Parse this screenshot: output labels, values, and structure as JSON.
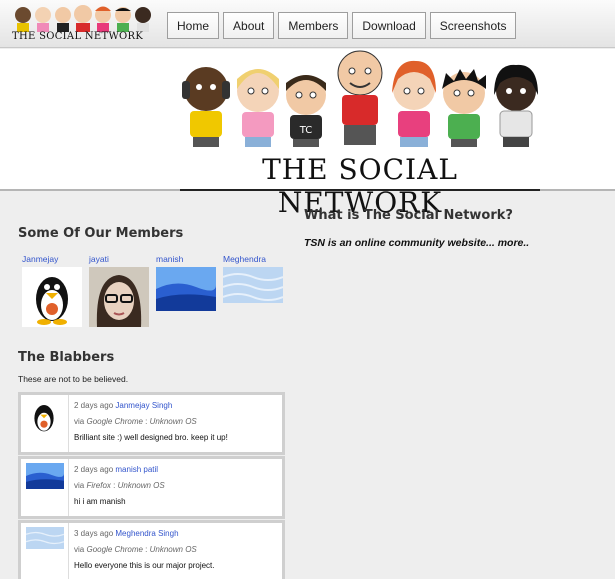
{
  "header": {
    "logo_text": "THE SOCIAL NETWORK",
    "nav": [
      "Home",
      "About",
      "Members",
      "Download",
      "Screenshots"
    ]
  },
  "banner": {
    "title": "THE SOCIAL NETWORK"
  },
  "members_section": {
    "title": "Some Of Our Members",
    "members": [
      {
        "name": "Janmejay",
        "avatar": "linux-penguin"
      },
      {
        "name": "jayati",
        "avatar": "girl-with-glasses"
      },
      {
        "name": "manish",
        "avatar": "blue-landscape"
      },
      {
        "name": "Meghendra",
        "avatar": "light-blue-waves"
      }
    ]
  },
  "blabbers": {
    "title": "The Blabbers",
    "subtitle": "These are not to be believed.",
    "comments": [
      {
        "when": "2 days ago",
        "author": "Janmejay Singh",
        "via_label": "via",
        "browser": "Google Chrome",
        "os": "Unknown OS",
        "text": "Brilliant site :) well designed bro. keep it up!",
        "avatar": "linux-penguin"
      },
      {
        "when": "2 days ago",
        "author": "manish patil",
        "via_label": "via",
        "browser": "Firefox",
        "os": "Unknown OS",
        "text": "hi i am manish",
        "avatar": "blue-landscape"
      },
      {
        "when": "3 days ago",
        "author": "Meghendra Singh",
        "via_label": "via",
        "browser": "Google Chrome",
        "os": "Unknown OS",
        "text": "Hello everyone this is our major project.",
        "avatar": "light-blue-waves"
      }
    ]
  },
  "about": {
    "title": "What is The Social Network?",
    "text": "TSN is an online community website...",
    "more": "more.."
  },
  "colors": {
    "link": "#3355cc",
    "background": "#eeeeee"
  }
}
